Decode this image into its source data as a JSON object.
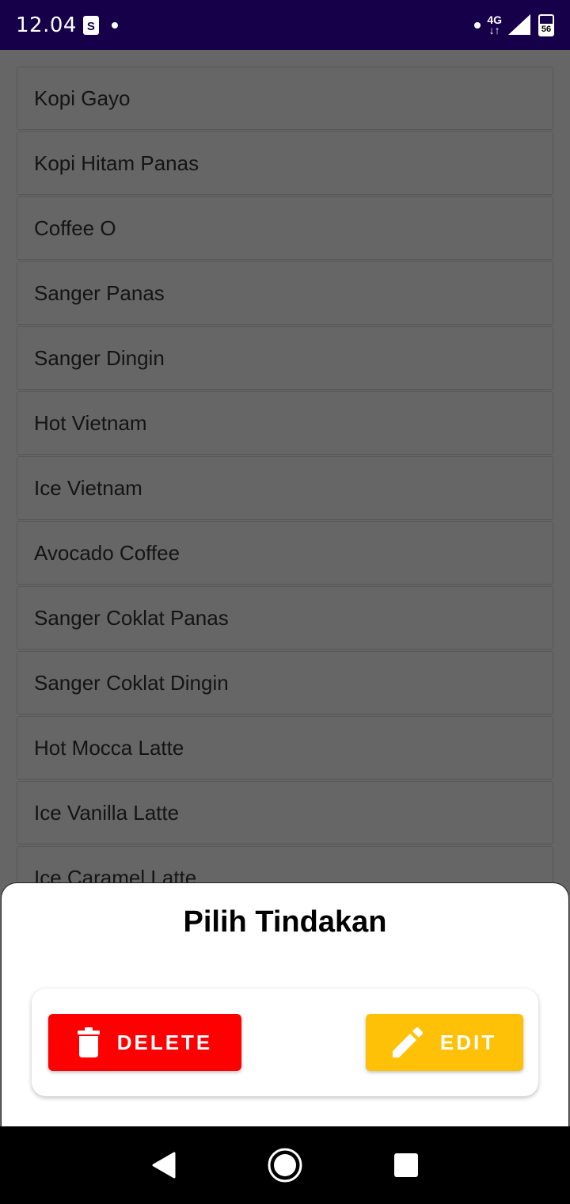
{
  "status_bar": {
    "time": "12.04",
    "shop_icon_letter": "S",
    "network": "4G",
    "battery": "56"
  },
  "menu_items": [
    "Kopi Gayo",
    "Kopi Hitam Panas",
    "Coffee O",
    "Sanger Panas",
    "Sanger Dingin",
    "Hot Vietnam",
    "Ice Vietnam",
    "Avocado Coffee",
    "Sanger Coklat Panas",
    "Sanger Coklat Dingin",
    "Hot Mocca Latte",
    "Ice Vanilla Latte",
    "Ice Caramel Latte"
  ],
  "sheet": {
    "title": "Pilih Tindakan",
    "delete_label": "DELETE",
    "edit_label": "EDIT"
  },
  "colors": {
    "status_bar": "#16004a",
    "delete": "#ff0000",
    "edit": "#ffc107"
  },
  "icons": {
    "delete": "trash-icon",
    "edit": "pencil-icon",
    "back": "back-triangle-icon",
    "home": "home-circle-icon",
    "recents": "recents-square-icon"
  }
}
